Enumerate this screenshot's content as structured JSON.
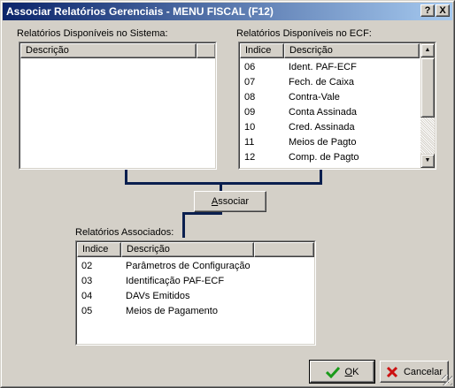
{
  "window": {
    "title": "Associar Relatórios Gerenciais - MENU FISCAL (F12)",
    "help_button": "?",
    "close_button": "X"
  },
  "system_panel": {
    "label": "Relatórios Disponíveis no Sistema:",
    "columns": [
      "Descrição",
      ""
    ],
    "rows": []
  },
  "ecf_panel": {
    "label": "Relatórios Disponíveis no ECF:",
    "columns": [
      "Indice",
      "Descrição"
    ],
    "rows": [
      {
        "indice": "06",
        "descricao": "Ident. PAF-ECF"
      },
      {
        "indice": "07",
        "descricao": "Fech. de Caixa"
      },
      {
        "indice": "08",
        "descricao": "Contra-Vale"
      },
      {
        "indice": "09",
        "descricao": "Conta Assinada"
      },
      {
        "indice": "10",
        "descricao": "Cred. Assinada"
      },
      {
        "indice": "11",
        "descricao": "Meios de Pagto"
      },
      {
        "indice": "12",
        "descricao": "Comp. de Pagto"
      }
    ]
  },
  "associate_button": {
    "accel": "A",
    "rest": "ssociar"
  },
  "associated_panel": {
    "label": "Relatórios Associados:",
    "columns": [
      "Indice",
      "Descrição",
      ""
    ],
    "rows": [
      {
        "indice": "02",
        "descricao": "Parâmetros de Configuração"
      },
      {
        "indice": "03",
        "descricao": "Identificação PAF-ECF"
      },
      {
        "indice": "04",
        "descricao": "DAVs Emitidos"
      },
      {
        "indice": "05",
        "descricao": "Meios de Pagamento"
      }
    ]
  },
  "ok_button": {
    "accel": "O",
    "rest": "K",
    "icon": "check-icon",
    "icon_color": "#1a9a1a"
  },
  "cancel_button": {
    "label": "Cancelar",
    "icon": "x-icon",
    "icon_color": "#cc1111"
  },
  "colors": {
    "title_start": "#0a246a",
    "title_end": "#a6caf0",
    "face": "#d4d0c8",
    "connector": "#0a1f4f"
  }
}
